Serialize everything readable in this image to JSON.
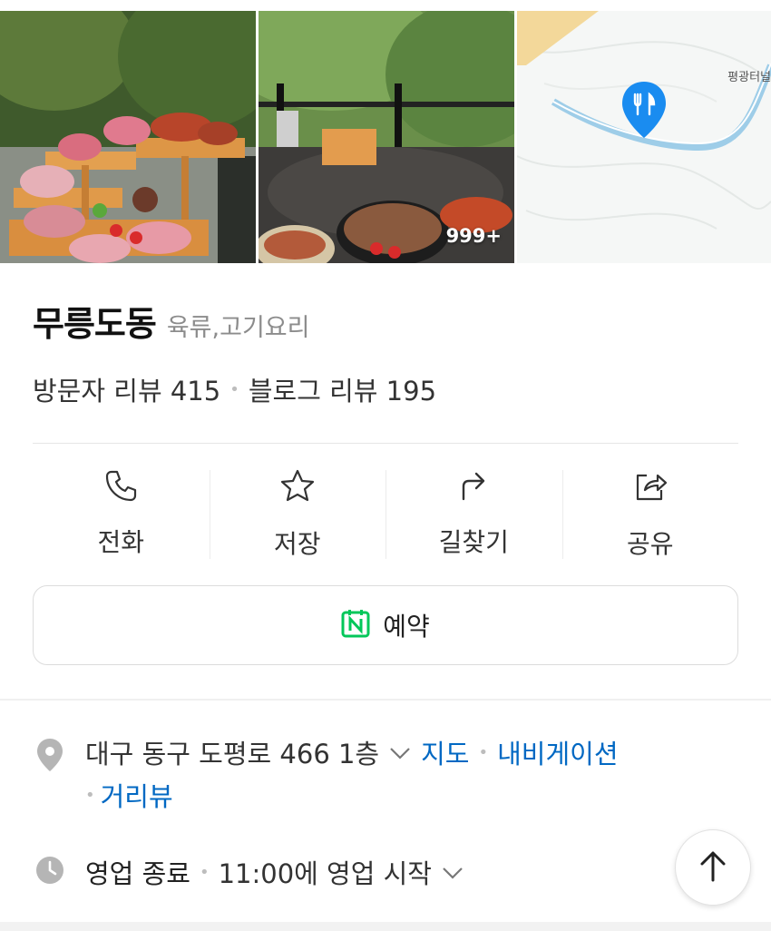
{
  "photos": {
    "badge": "999+",
    "map_label": "평광터널"
  },
  "place": {
    "name": "무릉도동",
    "category": "육류,고기요리",
    "visitor_reviews": "방문자 리뷰 415",
    "blog_reviews": "블로그 리뷰 195"
  },
  "actions": [
    {
      "label": "전화",
      "icon": "phone-icon"
    },
    {
      "label": "저장",
      "icon": "star-icon"
    },
    {
      "label": "길찾기",
      "icon": "directions-icon"
    },
    {
      "label": "공유",
      "icon": "share-icon"
    }
  ],
  "reserve": {
    "label": "예약",
    "icon": "naver-calendar-icon",
    "icon_color": "#03c75a"
  },
  "address": {
    "text": "대구 동구 도평로 466 1층",
    "map_link": "지도",
    "navigation_link": "내비게이션",
    "street_view_link": "거리뷰"
  },
  "hours": {
    "status": "영업 종료",
    "next_open": "11:00에 영업 시작"
  },
  "colors": {
    "link": "#0068c3",
    "accent_green": "#03c75a",
    "pin_blue": "#1a8cf0"
  }
}
